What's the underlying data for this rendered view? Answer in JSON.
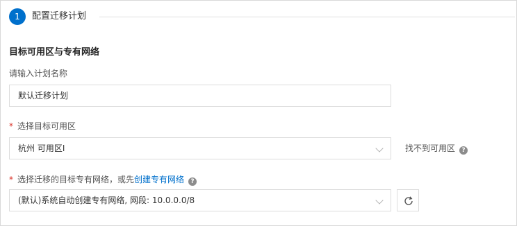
{
  "step": {
    "number": "1",
    "title": "配置迁移计划"
  },
  "section_title": "目标可用区与专有网络",
  "plan_name": {
    "label": "请输入计划名称",
    "value": "默认迁移计划"
  },
  "zone": {
    "required_mark": "*",
    "label": "选择目标可用区",
    "selected": "杭州 可用区I",
    "not_found_text": "找不到可用区",
    "help_glyph": "?"
  },
  "vpc": {
    "required_mark": "*",
    "label_prefix": "选择迁移的目标专有网络，或先",
    "create_link": "创建专有网络",
    "help_glyph": "?",
    "selected": "(默认)系统自动创建专有网络, 网段: 10.0.0.0/8"
  },
  "icons": {
    "dropdown": "chevron-down-icon",
    "refresh": "refresh-icon",
    "help": "question-circle-icon"
  },
  "colors": {
    "accent": "#0070cc",
    "required": "#d93026",
    "border": "#dcdcdc"
  }
}
